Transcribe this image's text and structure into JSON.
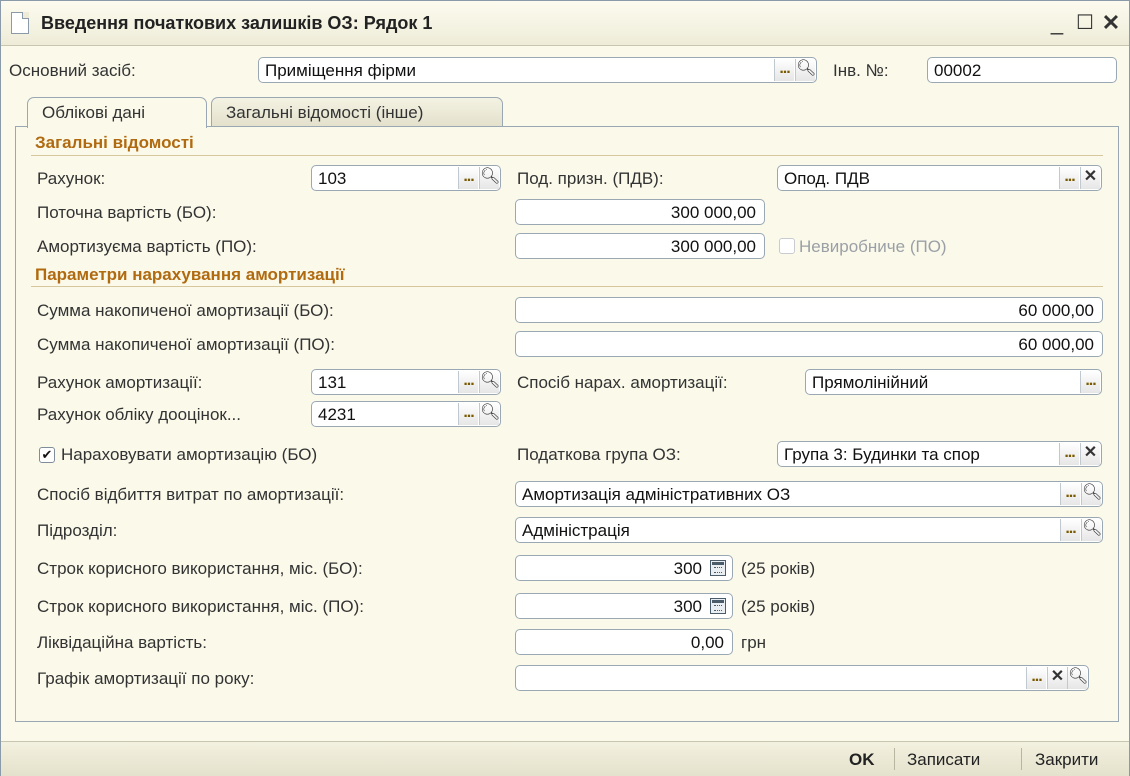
{
  "window": {
    "title": "Введення початкових залишків ОЗ: Рядок 1"
  },
  "top": {
    "asset_label": "Основний засіб:",
    "asset_value": "Приміщення фірми",
    "inv_label": "Інв. №:",
    "inv_value": "00002"
  },
  "tabs": [
    {
      "label": "Облікові дані",
      "active": true
    },
    {
      "label": "Загальні відомості (інше)",
      "active": false
    }
  ],
  "general": {
    "header": "Загальні відомості",
    "account_label": "Рахунок:",
    "account_value": "103",
    "tax_purpose_label": "Под. призн. (ПДВ):",
    "tax_purpose_value": "Опод. ПДВ",
    "current_cost_label": "Поточна вартість (БО):",
    "current_cost_value": "300 000,00",
    "depr_cost_label": "Амортизуєма вартість (ПО):",
    "depr_cost_value": "300 000,00",
    "nonprod_label": "Невиробниче (ПО)"
  },
  "depreciation": {
    "header": "Параметри нарахування амортизації",
    "accum_bo_label": "Сумма накопиченої амортизації (БО):",
    "accum_bo_value": "60 000,00",
    "accum_po_label": "Сумма накопиченої амортизації (ПО):",
    "accum_po_value": "60 000,00",
    "depr_account_label": "Рахунок амортизації:",
    "depr_account_value": "131",
    "method_label": "Спосіб нарах. амортизації:",
    "method_value": "Прямолінійний",
    "reval_account_label": "Рахунок обліку дооцінок...",
    "reval_account_value": "4231",
    "accrue_label": "Нараховувати амортизацію (БО)",
    "accrue_checked": true,
    "tax_group_label": "Податкова група ОЗ:",
    "tax_group_value": "Група 3: Будинки та спор",
    "expense_method_label": "Спосіб відбиття витрат по амортизації:",
    "expense_method_value": "Амортизація адміністративних ОЗ",
    "department_label": "Підрозділ:",
    "department_value": "Адміністрація",
    "life_bo_label": "Строк корисного використання, міс. (БО):",
    "life_bo_value": "300",
    "life_bo_years": "(25 років)",
    "life_po_label": "Строк корисного використання, міс. (ПО):",
    "life_po_value": "300",
    "life_po_years": "(25 років)",
    "salvage_label": "Ліквідаційна вартість:",
    "salvage_value": "0,00",
    "salvage_unit": "грн",
    "schedule_label": "Графік амортизації по року:",
    "schedule_value": ""
  },
  "buttons": {
    "ok": "OK",
    "save": "Записати",
    "close": "Закрити"
  },
  "colors": {
    "header_accent": "#b06a10",
    "background": "#fbf9ea"
  },
  "icons": [
    "document-icon",
    "minimize-icon",
    "maximize-icon",
    "close-icon",
    "search-icon",
    "ellipsis-icon",
    "clear-icon",
    "calendar-icon",
    "checkmark-icon"
  ]
}
